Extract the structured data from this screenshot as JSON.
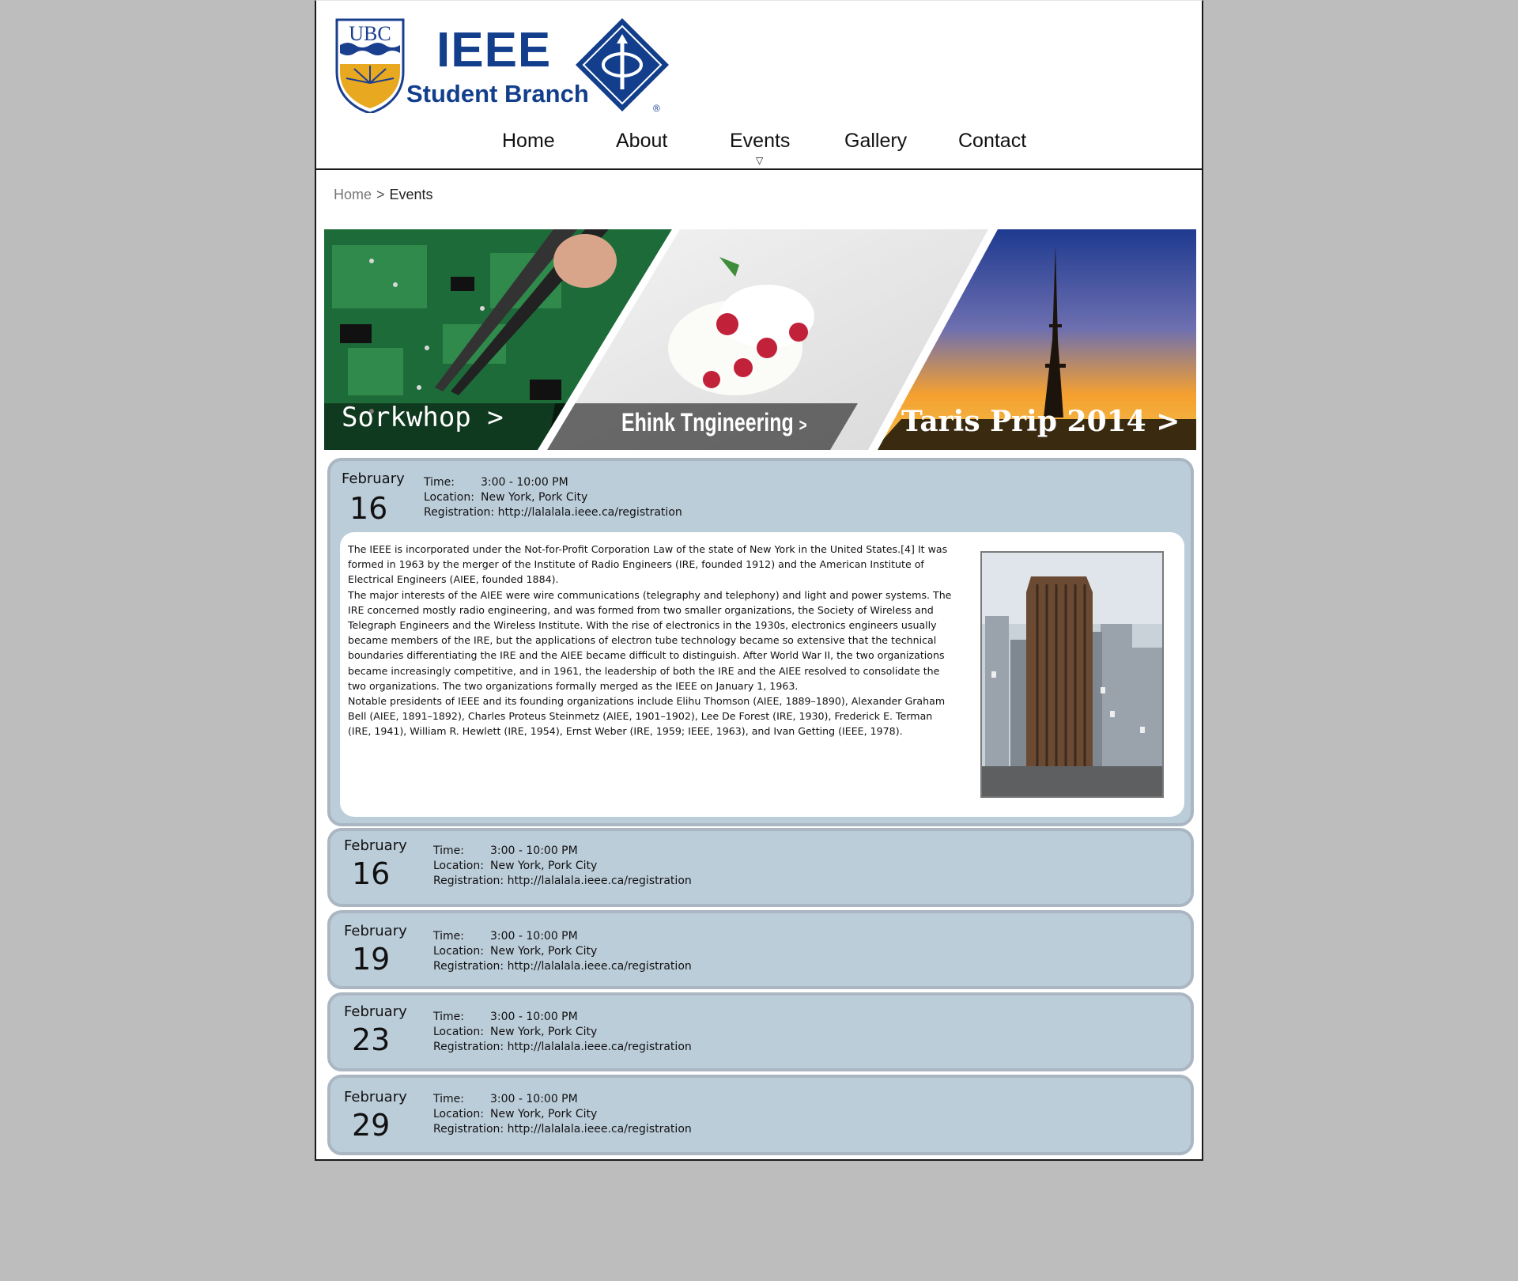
{
  "header": {
    "ubc_text": "UBC",
    "ieee_text": "IEEE",
    "branch_text": "Student Branch",
    "registered_mark": "®"
  },
  "nav": {
    "items": [
      {
        "label": "Home"
      },
      {
        "label": "About"
      },
      {
        "label": "Events"
      },
      {
        "label": "Gallery"
      },
      {
        "label": "Contact"
      }
    ],
    "active": "Events",
    "caret": "▽"
  },
  "breadcrumb": {
    "home": "Home",
    "separator": ">",
    "current": "Events"
  },
  "banner": {
    "panels": [
      {
        "label": "Sorkwhop",
        "arrow": ">"
      },
      {
        "label": "Ehink Tngineering",
        "arrow": ">"
      },
      {
        "label": "Taris Prip 2014",
        "arrow": ">"
      }
    ]
  },
  "labels": {
    "time": "Time:",
    "location": "Location:",
    "registration": "Registration:"
  },
  "events": [
    {
      "month": "February",
      "day": "16",
      "time": "3:00 - 10:00 PM",
      "location": "New York, Pork City",
      "registration": "http://lalalala.ieee.ca/registration",
      "expanded": true,
      "description": [
        "The IEEE is incorporated under the Not-for-Profit Corporation Law of the state of New York in the United States.[4] It was formed in 1963 by the merger of the Institute of Radio Engineers (IRE, founded 1912) and the American Institute of Electrical Engineers (AIEE, founded 1884).",
        "The major interests of the AIEE were wire communications (telegraphy and telephony) and light and power systems. The IRE concerned mostly radio engineering, and was formed from two smaller organizations, the Society of Wireless and Telegraph Engineers and the Wireless Institute. With the rise of electronics in the 1930s, electronics engineers usually became members of the IRE, but the applications of electron tube technology became so extensive that the technical boundaries differentiating the IRE and the AIEE became difficult to distinguish. After World War II, the two organizations became increasingly competitive, and in 1961, the leadership of both the IRE and the AIEE resolved to consolidate the two organizations. The two organizations formally merged as the IEEE on January 1, 1963.",
        "Notable presidents of IEEE and its founding organizations include Elihu Thomson (AIEE, 1889–1890), Alexander Graham Bell (AIEE, 1891–1892), Charles Proteus Steinmetz (AIEE, 1901–1902), Lee De Forest (IRE, 1930), Frederick E. Terman (IRE, 1941), William R. Hewlett (IRE, 1954), Ernst Weber (IRE, 1959; IEEE, 1963), and Ivan Getting (IEEE, 1978)."
      ]
    },
    {
      "month": "February",
      "day": "16",
      "time": "3:00 - 10:00 PM",
      "location": "New York, Pork City",
      "registration": "http://lalalala.ieee.ca/registration",
      "expanded": false
    },
    {
      "month": "February",
      "day": "19",
      "time": "3:00 - 10:00 PM",
      "location": "New York, Pork City",
      "registration": "http://lalalala.ieee.ca/registration",
      "expanded": false
    },
    {
      "month": "February",
      "day": "23",
      "time": "3:00 - 10:00 PM",
      "location": "New York, Pork City",
      "registration": "http://lalalala.ieee.ca/registration",
      "expanded": false
    },
    {
      "month": "February",
      "day": "29",
      "time": "3:00 - 10:00 PM",
      "location": "New York, Pork City",
      "registration": "http://lalalala.ieee.ca/registration",
      "expanded": false
    }
  ],
  "colors": {
    "brand_blue": "#123e8c",
    "card_bg": "#bccdda",
    "card_border": "#aab7c2",
    "page_bg": "#bdbdbd"
  }
}
